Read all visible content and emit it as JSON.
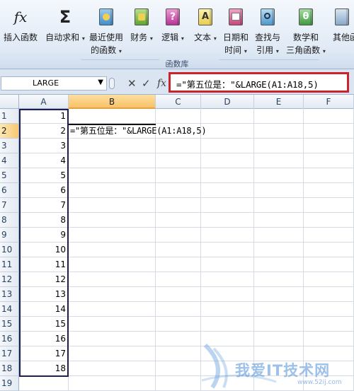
{
  "ribbon": {
    "buttons": [
      {
        "label": "插入函数",
        "label2": "",
        "icon": "fx-icon"
      },
      {
        "label": "自动求和",
        "label2": "",
        "icon": "sigma-icon",
        "dropdown": true
      },
      {
        "label": "最近使用",
        "label2": "的函数",
        "icon": "recent-book-icon",
        "dropdown": true
      },
      {
        "label": "财务",
        "label2": "",
        "icon": "finance-book-icon",
        "dropdown": true
      },
      {
        "label": "逻辑",
        "label2": "",
        "icon": "logic-book-icon",
        "dropdown": true
      },
      {
        "label": "文本",
        "label2": "",
        "icon": "text-book-icon",
        "dropdown": true
      },
      {
        "label": "日期和",
        "label2": "时间",
        "icon": "date-book-icon",
        "dropdown": true
      },
      {
        "label": "查找与",
        "label2": "引用",
        "icon": "lookup-book-icon",
        "dropdown": true
      },
      {
        "label": "数学和",
        "label2": "三角函数",
        "icon": "math-book-icon",
        "dropdown": true
      },
      {
        "label": "其他函",
        "label2": "",
        "icon": "other-book-icon"
      }
    ],
    "group_label": "函数库",
    "fx_glyph": "fx",
    "sigma_glyph": "Σ",
    "text_glyph": "A",
    "logic_glyph": "?",
    "math_glyph": "θ"
  },
  "formula_bar": {
    "name_box": "LARGE",
    "name_box_arrow": "▼",
    "cancel_glyph": "✕",
    "enter_glyph": "✓",
    "fx_glyph": "fx",
    "formula": "=\"第五位是：\"&LARGE(A1:A18,5)"
  },
  "grid": {
    "columns": [
      "A",
      "B",
      "C",
      "D",
      "E",
      "F"
    ],
    "rows": [
      {
        "num": "1",
        "a": "1",
        "b": ""
      },
      {
        "num": "2",
        "a": "2",
        "b": "=\"第五位是：\"&LARGE(A1:A18,5)"
      },
      {
        "num": "3",
        "a": "3",
        "b": ""
      },
      {
        "num": "4",
        "a": "4",
        "b": ""
      },
      {
        "num": "5",
        "a": "5",
        "b": ""
      },
      {
        "num": "6",
        "a": "6",
        "b": ""
      },
      {
        "num": "7",
        "a": "7",
        "b": ""
      },
      {
        "num": "8",
        "a": "8",
        "b": ""
      },
      {
        "num": "9",
        "a": "9",
        "b": ""
      },
      {
        "num": "10",
        "a": "10",
        "b": ""
      },
      {
        "num": "11",
        "a": "11",
        "b": ""
      },
      {
        "num": "12",
        "a": "12",
        "b": ""
      },
      {
        "num": "13",
        "a": "13",
        "b": ""
      },
      {
        "num": "14",
        "a": "14",
        "b": ""
      },
      {
        "num": "15",
        "a": "15",
        "b": ""
      },
      {
        "num": "16",
        "a": "16",
        "b": ""
      },
      {
        "num": "17",
        "a": "17",
        "b": ""
      },
      {
        "num": "18",
        "a": "18",
        "b": ""
      },
      {
        "num": "19",
        "a": "",
        "b": ""
      }
    ]
  },
  "watermark": {
    "text": "我爱IT技术网",
    "sub": "www.52ij.com"
  },
  "colors": {
    "accent_red": "#c9242b",
    "selected_header": "#f9c168"
  }
}
